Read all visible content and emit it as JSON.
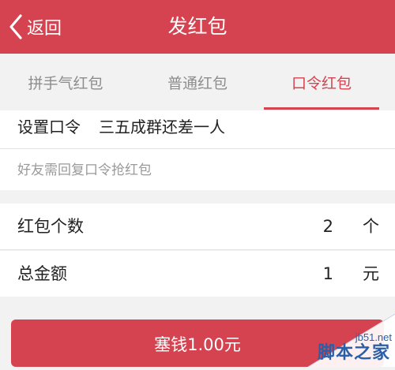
{
  "header": {
    "back_label": "返回",
    "title": "发红包"
  },
  "tabs": [
    {
      "label": "拼手气红包",
      "active": false
    },
    {
      "label": "普通红包",
      "active": false
    },
    {
      "label": "口令红包",
      "active": true
    }
  ],
  "password": {
    "label": "设置口令",
    "value": "三五成群还差一人"
  },
  "hint": "好友需回复口令抢红包",
  "count": {
    "label": "红包个数",
    "value": "2",
    "unit": "个"
  },
  "amount": {
    "label": "总金额",
    "value": "1",
    "unit": "元"
  },
  "submit_label": "塞钱1.00元",
  "watermark": {
    "url": "jb51.net",
    "text": "脚本之家"
  },
  "colors": {
    "accent": "#d4434f",
    "background": "#f2f2f2",
    "hint": "#9a9a9a"
  },
  "icons": {
    "back": "chevron-left-icon"
  }
}
